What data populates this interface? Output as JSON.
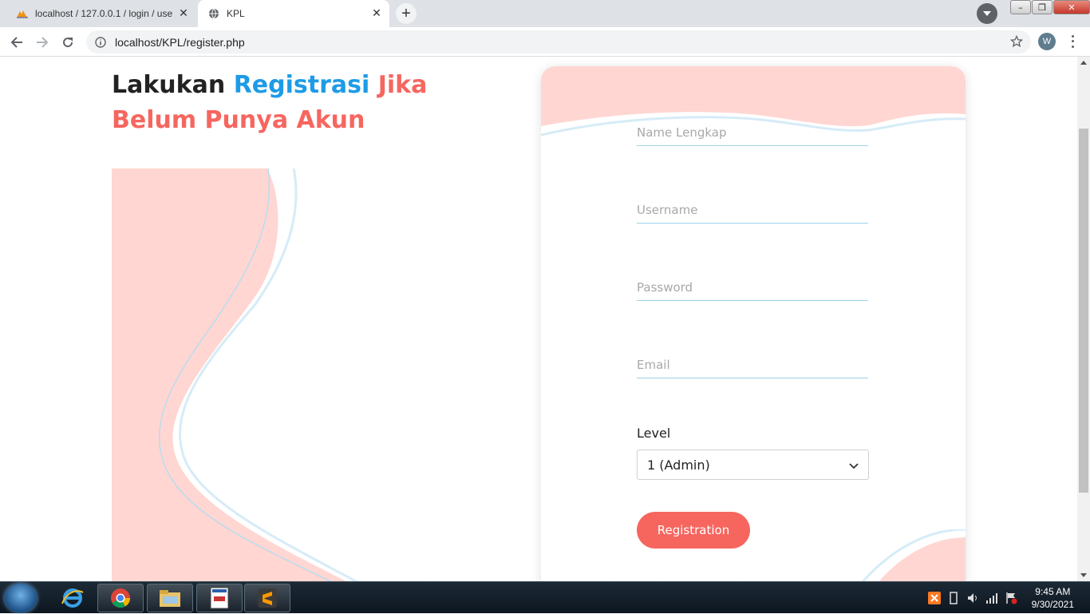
{
  "browser": {
    "tabs": [
      {
        "title": "localhost / 127.0.0.1 / login / use",
        "active": false
      },
      {
        "title": "KPL",
        "active": true
      }
    ],
    "url": "localhost/KPL/register.php",
    "profile_initial": "W"
  },
  "page": {
    "heading": {
      "part1": "Lakukan",
      "part2": "Registrasi",
      "part3": "Jika Belum Punya Akun"
    },
    "form": {
      "name_placeholder": "Name Lengkap",
      "username_placeholder": "Username",
      "password_placeholder": "Password",
      "email_placeholder": "Email",
      "level_label": "Level",
      "level_selected": "1 (Admin)",
      "submit_label": "Registration"
    },
    "colors": {
      "accent_blue": "#1e9be6",
      "accent_red": "#f6665f",
      "wave_pink": "#ffd6d2"
    }
  },
  "taskbar": {
    "time": "9:45 AM",
    "date": "9/30/2021",
    "apps": [
      "internet-explorer",
      "chrome",
      "file-explorer",
      "xampp-control",
      "sublime-text"
    ]
  }
}
